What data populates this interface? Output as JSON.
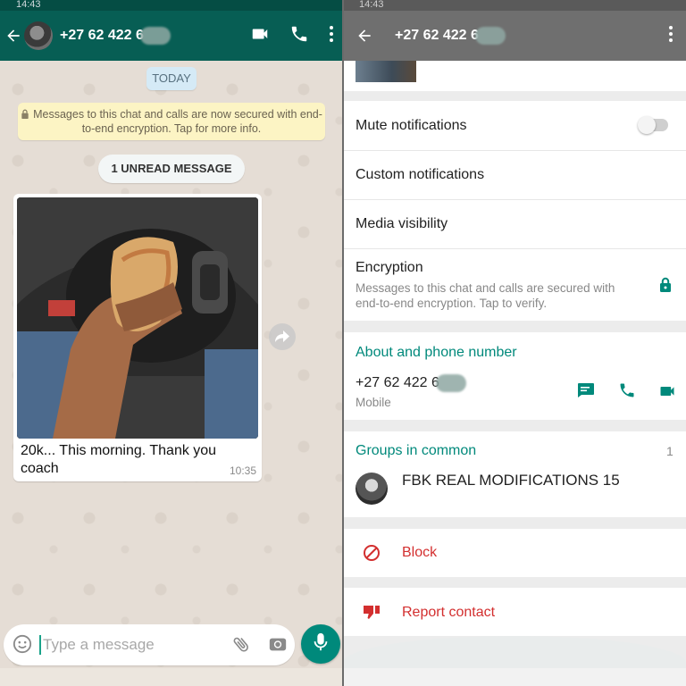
{
  "status_bar": {
    "left_time": "14:43",
    "right_time": "14:43"
  },
  "chat": {
    "contact_name": "+27 62 422 6",
    "date_chip": "TODAY",
    "encryption_notice": "Messages to this chat and calls are now secured with end-to-end encryption. Tap for more info.",
    "unread_chip": "1 UNREAD MESSAGE",
    "message": {
      "caption": "20k... This morning. Thank you coach",
      "time": "10:35"
    },
    "input_placeholder": "Type a message"
  },
  "info": {
    "contact_name": "+27 62 422 6",
    "mute_label": "Mute notifications",
    "mute_on": false,
    "custom_label": "Custom notifications",
    "media_label": "Media visibility",
    "encryption_title": "Encryption",
    "encryption_desc": "Messages to this chat and calls are secured with end-to-end encryption. Tap to verify.",
    "about_title": "About and phone number",
    "phone": "+27 62 422 6",
    "phone_type": "Mobile",
    "groups_title": "Groups in common",
    "groups_count": "1",
    "group_name": "FBK REAL MODIFICATIONS 15",
    "block_label": "Block",
    "report_label": "Report contact"
  },
  "colors": {
    "whatsapp_teal": "#075e54",
    "accent": "#00897b",
    "danger": "#d32f2f"
  },
  "icons": [
    "back-arrow-icon",
    "video-call-icon",
    "phone-icon",
    "more-vert-icon",
    "lock-icon",
    "forward-icon",
    "emoji-icon",
    "attach-icon",
    "camera-icon",
    "mic-icon",
    "message-icon",
    "block-icon",
    "thumbs-down-icon"
  ]
}
